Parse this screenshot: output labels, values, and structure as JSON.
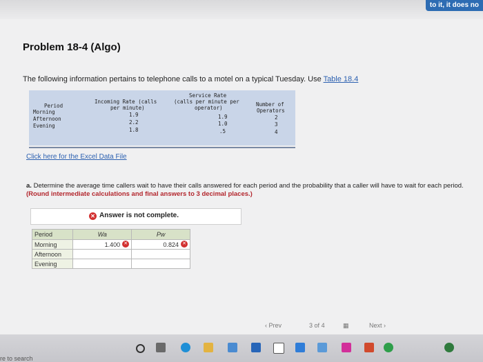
{
  "corner_text": "to it, it does no",
  "problem_title": "Problem 18-4 (Algo)",
  "intro_text": "The following information pertains to telephone calls to a motel on a typical Tuesday. Use ",
  "intro_link": "Table 18.4",
  "data_table": {
    "header_service": "Service Rate",
    "header_period": "Period",
    "header_incoming": "Incoming Rate (calls",
    "header_incoming2": "per minute)",
    "header_service2": "(calls per minute per",
    "header_service3": "operator)",
    "header_ops": "Number of",
    "header_ops2": "Operators",
    "rows": [
      {
        "period": "Morning",
        "incoming": "1.9",
        "service": "1.9",
        "ops": "2"
      },
      {
        "period": "Afternoon",
        "incoming": "2.2",
        "service": "1.0",
        "ops": "3"
      },
      {
        "period": "Evening",
        "incoming": "1.8",
        "service": ".5",
        "ops": "4"
      }
    ]
  },
  "excel_link": "Click here for the Excel Data File",
  "question_label": "a.",
  "question_text": "Determine the average time callers wait to have their calls answered for each period and the probability that a caller will have to wait for each period.",
  "question_bold": "(Round intermediate calculations and final answers to 3 decimal places.)",
  "answer_status": "Answer is not complete.",
  "answer_table": {
    "col_period": "Period",
    "col_wa": "Wa",
    "col_pw": "Pw",
    "rows": [
      {
        "period": "Morning",
        "wa": "1.400",
        "pw": "0.824"
      },
      {
        "period": "Afternoon",
        "wa": "",
        "pw": ""
      },
      {
        "period": "Evening",
        "wa": "",
        "pw": ""
      }
    ]
  },
  "pager": {
    "prev": "Prev",
    "page": "3",
    "of": "of",
    "total": "4",
    "next": "Next"
  },
  "taskbar_search": "re to search"
}
